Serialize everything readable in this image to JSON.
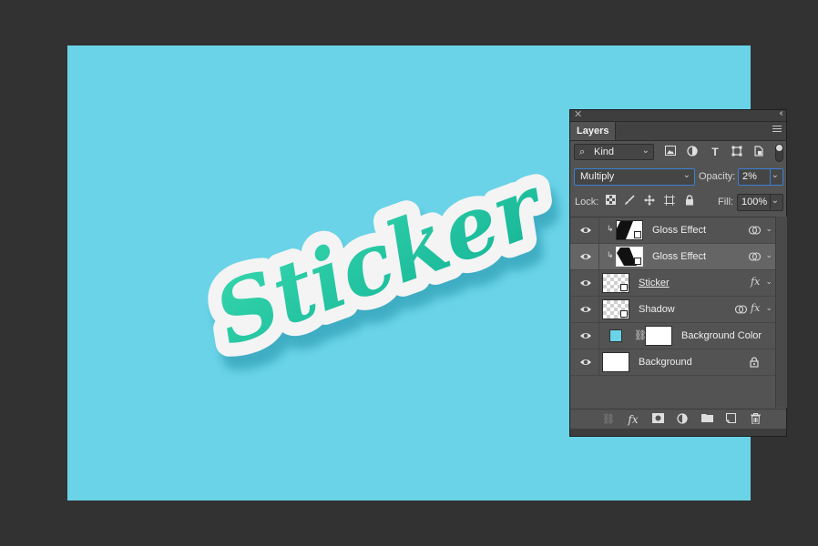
{
  "app": {
    "background_color": "#323232",
    "canvas_color": "#6ad3e7"
  },
  "artwork": {
    "text": "Sticker",
    "text_gradient": [
      "#2fd1a4",
      "#17b89b"
    ],
    "outline_color": "#f2f2f2"
  },
  "panel": {
    "tab_label": "Layers",
    "close_icon": "close-icon",
    "collapse_icon": "collapse-icon",
    "menu_icon": "panel-menu-icon",
    "filter": {
      "kind_label": "Kind",
      "icons": [
        "image-filter-icon",
        "adjustment-filter-icon",
        "type-filter-icon",
        "shape-filter-icon",
        "smart-object-filter-icon"
      ]
    },
    "blend_mode": "Multiply",
    "opacity_label": "Opacity:",
    "opacity_value": "2%",
    "lock_label": "Lock:",
    "fill_label": "Fill:",
    "fill_value": "100%",
    "accent_color": "#3c7fd4",
    "layers": [
      {
        "name": "Gloss Effect",
        "visible": true,
        "clipped": true,
        "thumb": "smart-object",
        "right_icons": [
          "blend-if-icon"
        ],
        "selected": false
      },
      {
        "name": "Gloss Effect",
        "visible": true,
        "clipped": true,
        "thumb": "smart-object",
        "right_icons": [
          "blend-if-icon"
        ],
        "selected": true
      },
      {
        "name": "Sticker",
        "visible": true,
        "clipped": false,
        "thumb": "checker-smart",
        "right_icons": [
          "fx-icon"
        ],
        "selected": false
      },
      {
        "name": "Shadow",
        "visible": true,
        "clipped": false,
        "thumb": "checker-smart",
        "right_icons": [
          "blend-if-icon",
          "fx-icon"
        ],
        "selected": false
      },
      {
        "name": "Background Color",
        "visible": true,
        "clipped": false,
        "thumb": "fill",
        "right_icons": [],
        "selected": false
      },
      {
        "name": "Background",
        "visible": true,
        "clipped": false,
        "thumb": "white",
        "right_icons": [
          "lock-icon"
        ],
        "selected": false
      }
    ],
    "bottom_icons": [
      "link-layers-icon",
      "add-style-icon",
      "add-mask-icon",
      "new-adjustment-icon",
      "new-group-icon",
      "new-layer-icon",
      "delete-layer-icon"
    ]
  }
}
